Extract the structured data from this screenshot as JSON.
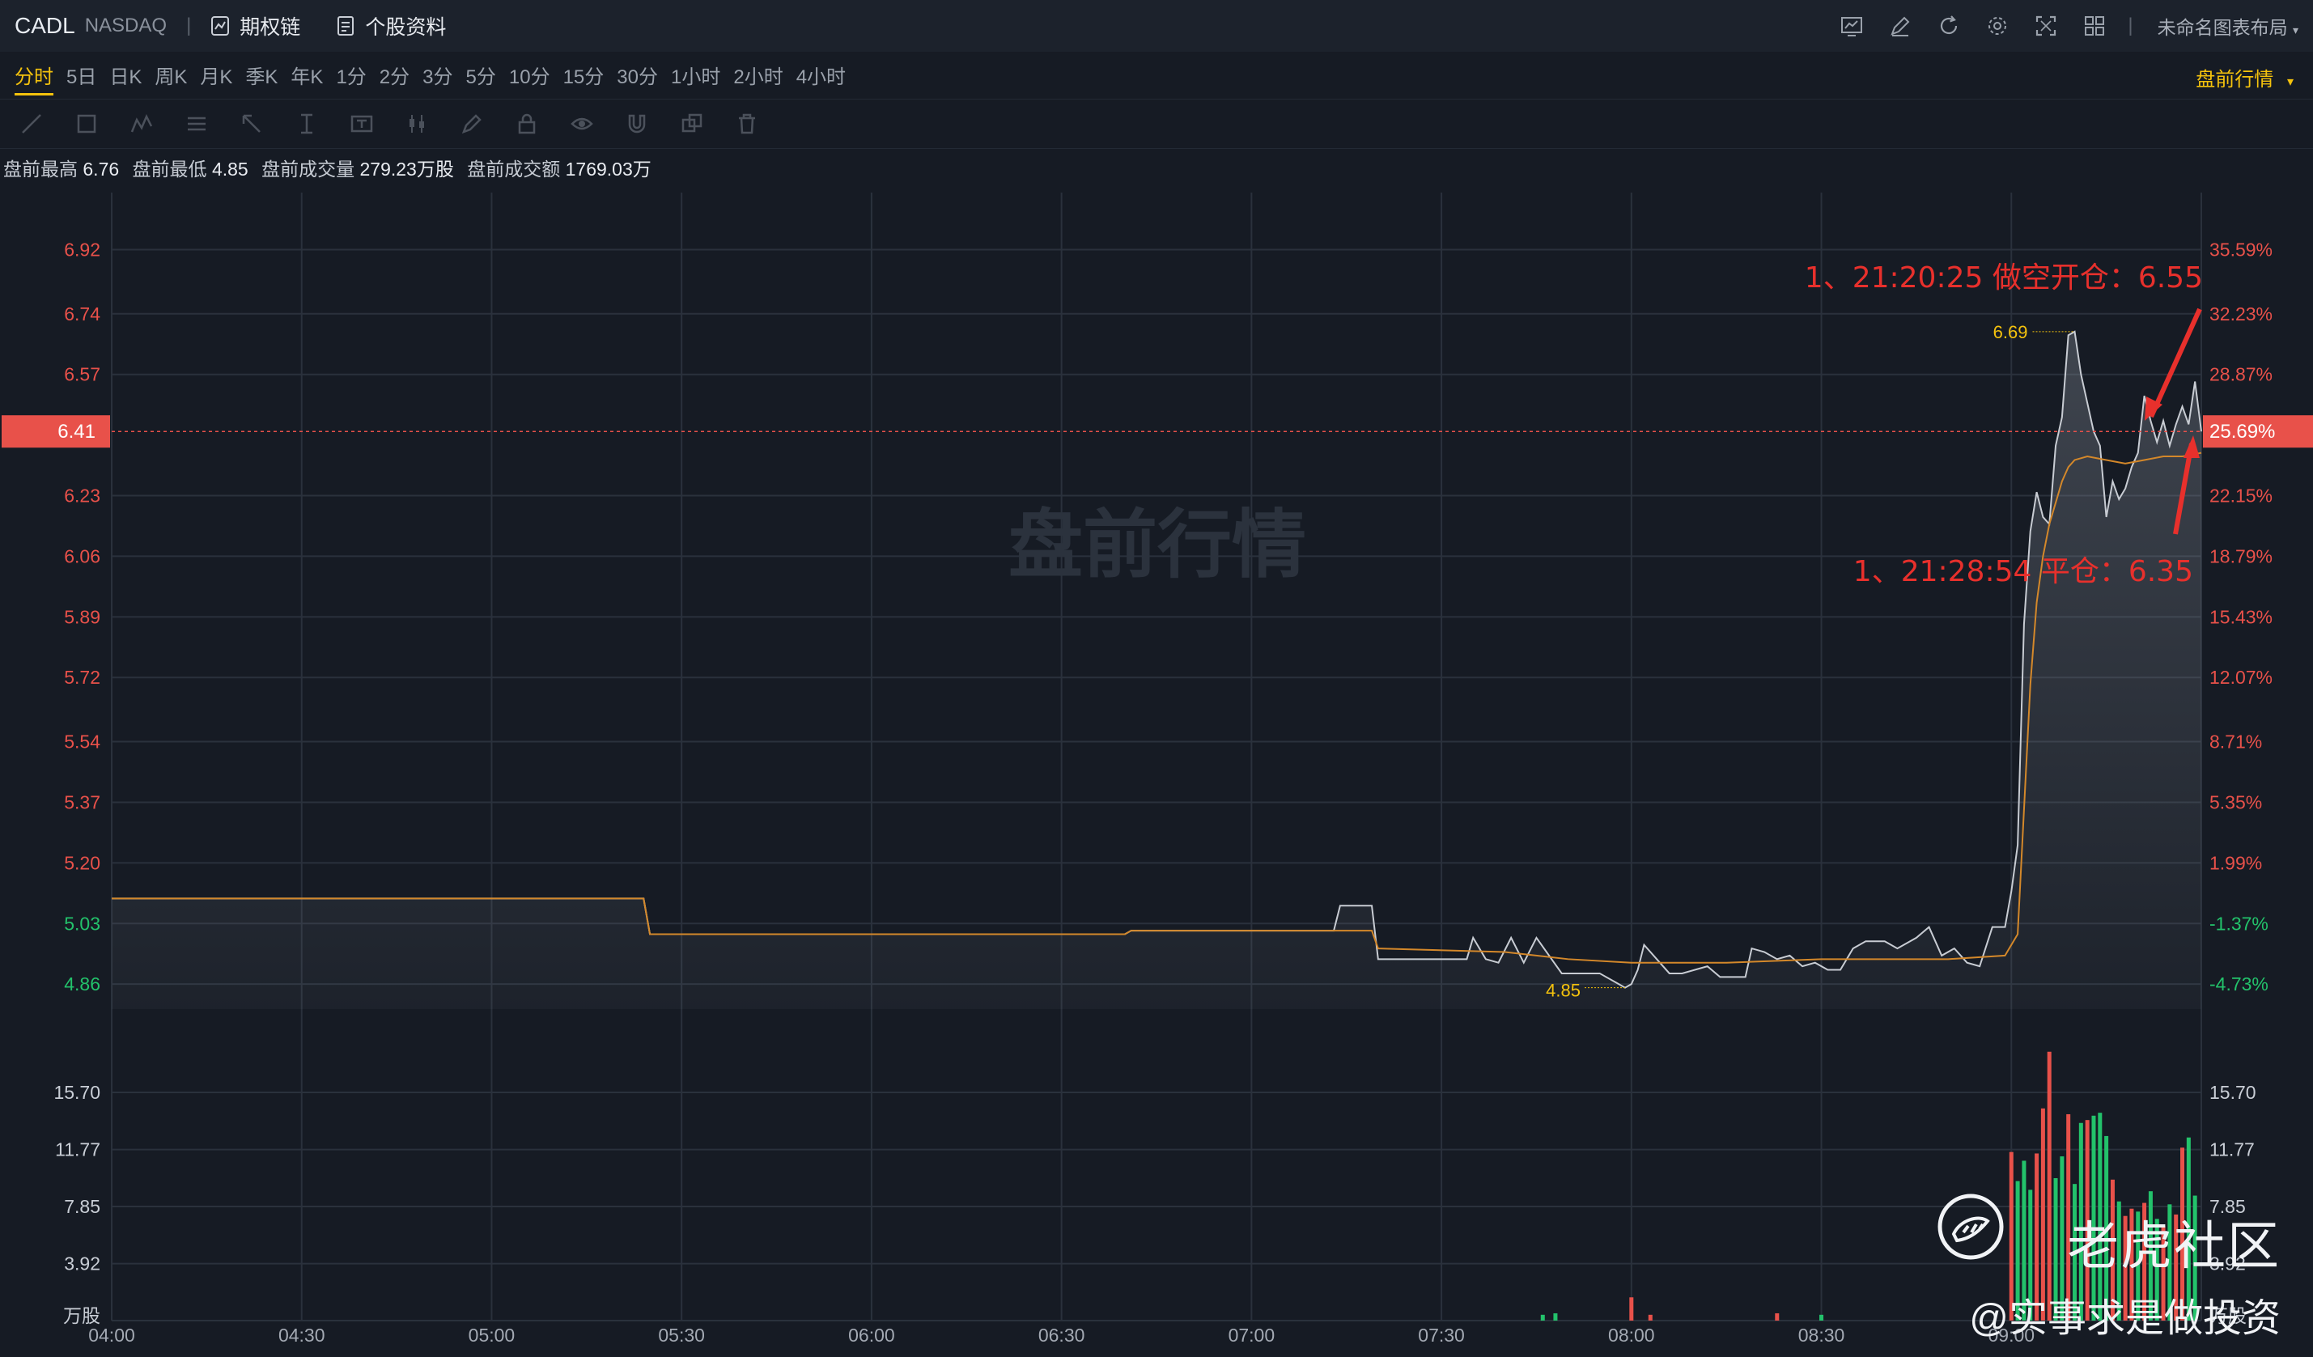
{
  "header": {
    "ticker": "CADL",
    "exchange": "NASDAQ",
    "separator": "|",
    "option_chain_label": "期权链",
    "profile_label": "个股资料",
    "layout_label": "未命名图表布局",
    "right_icons": [
      "indicator-icon",
      "draw-icon",
      "refresh-icon",
      "settings-icon",
      "fullscreen-icon",
      "grid-layout-icon"
    ]
  },
  "periods": [
    "分时",
    "5日",
    "日K",
    "周K",
    "月K",
    "季K",
    "年K",
    "1分",
    "2分",
    "3分",
    "5分",
    "10分",
    "15分",
    "30分",
    "1小时",
    "2小时",
    "4小时"
  ],
  "active_period": "分时",
  "mode_label": "盘前行情",
  "draw_tools": [
    "line-tool-icon",
    "rect-tool-icon",
    "pattern-tool-icon",
    "fib-tool-icon",
    "arrow-tool-icon",
    "measure-tool-icon",
    "text-tool-icon",
    "candle-tool-icon",
    "pen-tool-icon",
    "lock-icon",
    "eye-icon",
    "magnet-icon",
    "copy-icon",
    "trash-icon"
  ],
  "stats": {
    "high_label": "盘前最高",
    "high": "6.76",
    "low_label": "盘前最低",
    "low": "4.85",
    "volume_label": "盘前成交量",
    "volume": "279.23万股",
    "turnover_label": "盘前成交额",
    "turnover": "1769.03万"
  },
  "chart_data": {
    "type": "line",
    "title": "",
    "watermark": "盘前行情",
    "x_ticks": [
      "04:00",
      "04:30",
      "05:00",
      "05:30",
      "06:00",
      "06:30",
      "07:00",
      "07:30",
      "08:00",
      "08:30",
      "09:00"
    ],
    "x_range": [
      "04:00",
      "09:30"
    ],
    "price_ticks": [
      "6.92",
      "6.74",
      "6.57",
      "6.23",
      "6.06",
      "5.89",
      "5.72",
      "5.54",
      "5.37",
      "5.20",
      "5.03",
      "4.86"
    ],
    "pct_ticks": [
      "35.59%",
      "32.23%",
      "28.87%",
      "22.15%",
      "18.79%",
      "15.43%",
      "12.07%",
      "8.71%",
      "5.35%",
      "1.99%",
      "-1.37%",
      "-4.73%"
    ],
    "price_range": [
      4.79,
      7.08
    ],
    "prev_close": 5.1,
    "current_price": "6.41",
    "current_pct": "25.69%",
    "high_marker": "6.69",
    "low_marker": "4.85",
    "series": [
      {
        "name": "",
        "color": "#c8ccd3",
        "points": [
          [
            "04:00",
            5.1
          ],
          [
            "05:24",
            5.1
          ],
          [
            "05:25",
            5.0
          ],
          [
            "06:40",
            5.0
          ],
          [
            "06:41",
            5.01
          ],
          [
            "07:13",
            5.01
          ],
          [
            "07:14",
            5.08
          ],
          [
            "07:19",
            5.08
          ],
          [
            "07:20",
            4.93
          ],
          [
            "07:34",
            4.93
          ],
          [
            "07:35",
            4.99
          ],
          [
            "07:37",
            4.93
          ],
          [
            "07:39",
            4.92
          ],
          [
            "07:41",
            4.99
          ],
          [
            "07:43",
            4.92
          ],
          [
            "07:45",
            4.99
          ],
          [
            "07:47",
            4.94
          ],
          [
            "07:49",
            4.89
          ],
          [
            "07:55",
            4.89
          ],
          [
            "07:57",
            4.87
          ],
          [
            "07:58",
            4.86
          ],
          [
            "07:59",
            4.85
          ],
          [
            "08:00",
            4.86
          ],
          [
            "08:01",
            4.9
          ],
          [
            "08:02",
            4.97
          ],
          [
            "08:04",
            4.93
          ],
          [
            "08:06",
            4.89
          ],
          [
            "08:08",
            4.89
          ],
          [
            "08:12",
            4.91
          ],
          [
            "08:14",
            4.88
          ],
          [
            "08:18",
            4.88
          ],
          [
            "08:19",
            4.96
          ],
          [
            "08:21",
            4.95
          ],
          [
            "08:23",
            4.93
          ],
          [
            "08:25",
            4.94
          ],
          [
            "08:27",
            4.91
          ],
          [
            "08:29",
            4.92
          ],
          [
            "08:31",
            4.9
          ],
          [
            "08:33",
            4.9
          ],
          [
            "08:35",
            4.96
          ],
          [
            "08:37",
            4.98
          ],
          [
            "08:40",
            4.98
          ],
          [
            "08:42",
            4.96
          ],
          [
            "08:45",
            4.99
          ],
          [
            "08:47",
            5.02
          ],
          [
            "08:49",
            4.94
          ],
          [
            "08:51",
            4.96
          ],
          [
            "08:53",
            4.92
          ],
          [
            "08:55",
            4.91
          ],
          [
            "08:57",
            5.02
          ],
          [
            "08:59",
            5.02
          ],
          [
            "09:00",
            5.12
          ],
          [
            "09:01",
            5.25
          ],
          [
            "09:02",
            5.87
          ],
          [
            "09:03",
            6.13
          ],
          [
            "09:04",
            6.24
          ],
          [
            "09:05",
            6.17
          ],
          [
            "09:06",
            6.15
          ],
          [
            "09:07",
            6.37
          ],
          [
            "09:08",
            6.45
          ],
          [
            "09:09",
            6.68
          ],
          [
            "09:10",
            6.69
          ],
          [
            "09:11",
            6.57
          ],
          [
            "09:12",
            6.49
          ],
          [
            "09:13",
            6.41
          ],
          [
            "09:14",
            6.37
          ],
          [
            "09:15",
            6.17
          ],
          [
            "09:16",
            6.27
          ],
          [
            "09:17",
            6.22
          ],
          [
            "09:18",
            6.25
          ],
          [
            "09:19",
            6.31
          ],
          [
            "09:20",
            6.35
          ],
          [
            "09:21",
            6.51
          ],
          [
            "09:22",
            6.44
          ],
          [
            "09:23",
            6.38
          ],
          [
            "09:24",
            6.44
          ],
          [
            "09:25",
            6.37
          ],
          [
            "09:26",
            6.43
          ],
          [
            "09:27",
            6.48
          ],
          [
            "09:28",
            6.43
          ],
          [
            "09:29",
            6.55
          ],
          [
            "09:30",
            6.41
          ]
        ]
      },
      {
        "name": "",
        "color": "#d4882a",
        "points": [
          [
            "04:00",
            5.1
          ],
          [
            "05:24",
            5.1
          ],
          [
            "05:25",
            5.0
          ],
          [
            "06:40",
            5.0
          ],
          [
            "06:41",
            5.01
          ],
          [
            "07:19",
            5.01
          ],
          [
            "07:20",
            4.96
          ],
          [
            "07:40",
            4.95
          ],
          [
            "07:50",
            4.93
          ],
          [
            "08:00",
            4.92
          ],
          [
            "08:15",
            4.92
          ],
          [
            "08:30",
            4.93
          ],
          [
            "08:50",
            4.93
          ],
          [
            "08:59",
            4.94
          ],
          [
            "09:01",
            5.0
          ],
          [
            "09:02",
            5.35
          ],
          [
            "09:03",
            5.7
          ],
          [
            "09:04",
            5.93
          ],
          [
            "09:05",
            6.06
          ],
          [
            "09:06",
            6.15
          ],
          [
            "09:07",
            6.21
          ],
          [
            "09:08",
            6.27
          ],
          [
            "09:09",
            6.31
          ],
          [
            "09:10",
            6.33
          ],
          [
            "09:12",
            6.34
          ],
          [
            "09:15",
            6.33
          ],
          [
            "09:18",
            6.32
          ],
          [
            "09:21",
            6.33
          ],
          [
            "09:24",
            6.34
          ],
          [
            "09:27",
            6.34
          ],
          [
            "09:30",
            6.35
          ]
        ]
      }
    ],
    "volume": {
      "unit": "万股",
      "ticks": [
        "15.70",
        "11.77",
        "7.85",
        "3.92"
      ],
      "range": [
        0,
        19.6
      ],
      "bars": [
        [
          "07:46",
          0.4,
          "green"
        ],
        [
          "07:48",
          0.5,
          "green"
        ],
        [
          "08:00",
          1.6,
          "red"
        ],
        [
          "08:03",
          0.4,
          "red"
        ],
        [
          "08:23",
          0.5,
          "red"
        ],
        [
          "08:30",
          0.4,
          "green"
        ],
        [
          "09:00",
          11.6,
          "red"
        ],
        [
          "09:01",
          9.6,
          "green"
        ],
        [
          "09:02",
          11.0,
          "green"
        ],
        [
          "09:03",
          9.0,
          "green"
        ],
        [
          "09:04",
          11.5,
          "red"
        ],
        [
          "09:05",
          14.6,
          "red"
        ],
        [
          "09:06",
          18.5,
          "red"
        ],
        [
          "09:07",
          9.8,
          "green"
        ],
        [
          "09:08",
          11.3,
          "green"
        ],
        [
          "09:09",
          14.2,
          "red"
        ],
        [
          "09:10",
          9.4,
          "green"
        ],
        [
          "09:11",
          13.6,
          "green"
        ],
        [
          "09:12",
          13.8,
          "red"
        ],
        [
          "09:13",
          14.1,
          "green"
        ],
        [
          "09:14",
          14.3,
          "green"
        ],
        [
          "09:15",
          12.7,
          "green"
        ],
        [
          "09:16",
          9.7,
          "red"
        ],
        [
          "09:17",
          8.2,
          "green"
        ],
        [
          "09:18",
          7.2,
          "red"
        ],
        [
          "09:19",
          7.7,
          "red"
        ],
        [
          "09:20",
          7.5,
          "green"
        ],
        [
          "09:21",
          8.1,
          "red"
        ],
        [
          "09:22",
          8.9,
          "green"
        ],
        [
          "09:23",
          7.0,
          "green"
        ],
        [
          "09:24",
          6.5,
          "red"
        ],
        [
          "09:25",
          8.0,
          "green"
        ],
        [
          "09:26",
          7.3,
          "red"
        ],
        [
          "09:27",
          11.9,
          "red"
        ],
        [
          "09:28",
          12.6,
          "green"
        ],
        [
          "09:29",
          8.6,
          "green"
        ]
      ]
    },
    "annotations": [
      {
        "text": "1、21:20:25 做空开仓：6.55",
        "color": "#e8302c"
      },
      {
        "text": "1、21:28:54 平仓：6.35",
        "color": "#e8302c"
      }
    ]
  },
  "watermark": {
    "brand": "老虎社区",
    "handle": "@实事求是做投资"
  },
  "colors": {
    "up": "#e8514a",
    "down": "#23c26b",
    "accent": "#f4c20d",
    "price_line": "#c8ccd3",
    "avg_line": "#d4882a"
  }
}
